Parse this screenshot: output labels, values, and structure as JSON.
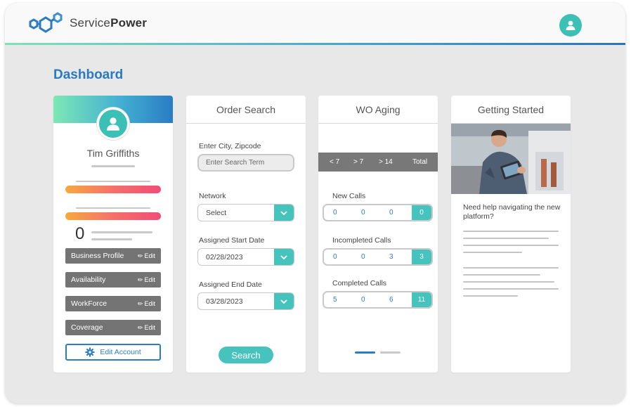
{
  "brand": {
    "name_light": "Service",
    "name_bold": "Power"
  },
  "page": {
    "title": "Dashboard"
  },
  "profile": {
    "name": "Tim Griffiths",
    "count": "0",
    "buttons": [
      {
        "label": "Business Profile",
        "edit": "Edit"
      },
      {
        "label": "Availability",
        "edit": "Edit"
      },
      {
        "label": "WorkForce",
        "edit": "Edit"
      },
      {
        "label": "Coverage",
        "edit": "Edit"
      }
    ],
    "edit_account": "Edit Account"
  },
  "order_search": {
    "title": "Order Search",
    "city_label": "Enter City, Zipcode",
    "city_placeholder": "Enter Search Term",
    "network_label": "Network",
    "network_value": "Select",
    "start_label": "Assigned Start Date",
    "start_value": "02/28/2023",
    "end_label": "Assigned End Date",
    "end_value": "03/28/2023",
    "search_button": "Search"
  },
  "wo_aging": {
    "title": "WO Aging",
    "columns": [
      "< 7",
      "> 7",
      "> 14",
      "Total"
    ],
    "rows": [
      {
        "label": "New Calls",
        "values": [
          "0",
          "0",
          "0",
          "0"
        ]
      },
      {
        "label": "Incompleted Calls",
        "values": [
          "0",
          "0",
          "3",
          "3"
        ]
      },
      {
        "label": "Completed Calls",
        "values": [
          "5",
          "0",
          "6",
          "11"
        ]
      }
    ],
    "pager_active": 1,
    "pager_total": 2
  },
  "getting_started": {
    "title": "Getting Started",
    "prompt": "Need help navigating the new platform?"
  },
  "colors": {
    "accent_teal": "#46c3bd",
    "brand_blue": "#2a7cc3",
    "tag_gray": "#747474"
  }
}
